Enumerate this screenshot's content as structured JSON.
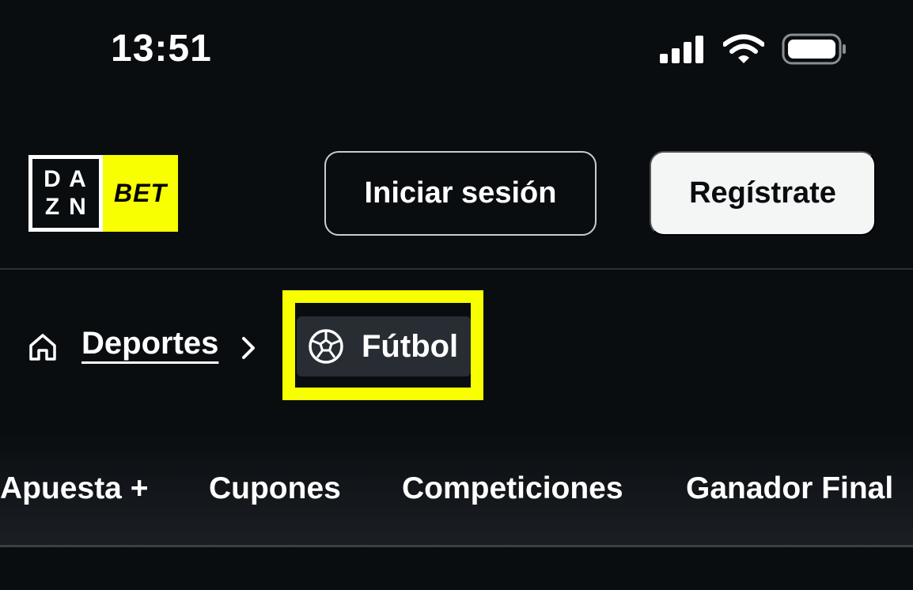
{
  "status_bar": {
    "time": "13:51",
    "icons": [
      "cellular-signal-icon",
      "wifi-icon",
      "battery-icon"
    ]
  },
  "header": {
    "logo": {
      "left_text_row1": [
        "D",
        "A"
      ],
      "left_text_row2": [
        "Z",
        "N"
      ],
      "right_text": "BET"
    },
    "login_label": "Iniciar sesión",
    "register_label": "Regístrate",
    "accent_color": "#f7ff00"
  },
  "breadcrumb": {
    "home_icon": "home-icon",
    "parent_label": "Deportes",
    "separator_icon": "chevron-right-icon",
    "current_icon": "soccer-ball-icon",
    "current_label": "Fútbol"
  },
  "tabs": {
    "items": [
      {
        "label": "Apuesta +"
      },
      {
        "label": "Cupones"
      },
      {
        "label": "Competiciones"
      },
      {
        "label": "Ganador Final"
      }
    ]
  }
}
